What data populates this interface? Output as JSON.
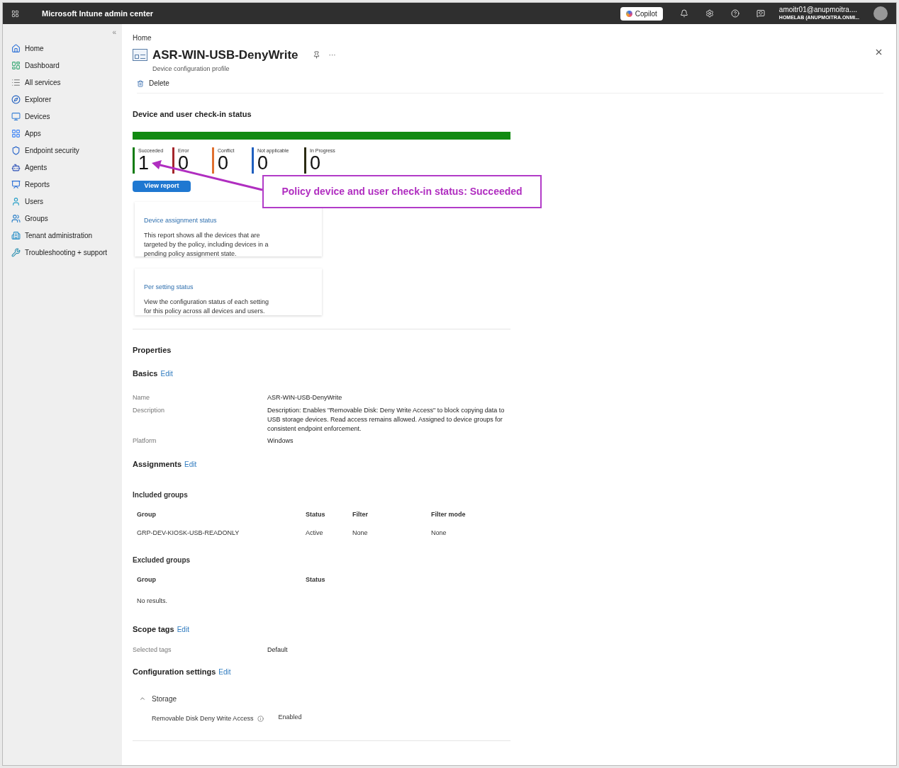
{
  "top_bar": {
    "title": "Microsoft Intune admin center",
    "copilot": "Copilot",
    "account": {
      "user": "amoitr01@anupmoitra....",
      "tenant": "HOMELAB (ANUPMOITRA.ONMI..."
    }
  },
  "sidebar": {
    "collapse": "«",
    "items": [
      {
        "label": "Home",
        "kind": "home"
      },
      {
        "label": "Dashboard",
        "kind": "dashboard"
      },
      {
        "label": "All services",
        "kind": "list"
      },
      {
        "label": "Explorer",
        "kind": "explorer"
      },
      {
        "label": "Devices",
        "kind": "devices"
      },
      {
        "label": "Apps",
        "kind": "apps"
      },
      {
        "label": "Endpoint security",
        "kind": "security"
      },
      {
        "label": "Agents",
        "kind": "agents"
      },
      {
        "label": "Reports",
        "kind": "reports"
      },
      {
        "label": "Users",
        "kind": "users"
      },
      {
        "label": "Groups",
        "kind": "groups"
      },
      {
        "label": "Tenant administration",
        "kind": "tenant"
      },
      {
        "label": "Troubleshooting + support",
        "kind": "tools"
      }
    ]
  },
  "breadcrumb": "Home",
  "header": {
    "title": "ASR-WIN-USB-DenyWrite",
    "subtitle": "Device configuration profile",
    "more": "···"
  },
  "toolbar": {
    "delete": "Delete"
  },
  "checkin": {
    "title": "Device and user check-in status",
    "bar": {
      "level": 1
    },
    "stats": [
      {
        "label": "Succeeded",
        "count": "1",
        "color": "#107c10"
      },
      {
        "label": "Error",
        "count": "0",
        "color": "#a4262c"
      },
      {
        "label": "Conflict",
        "count": "0",
        "color": "#e07030"
      },
      {
        "label": "Not applicable",
        "count": "0",
        "color": "#1f5fbf"
      },
      {
        "label": "In Progress",
        "count": "0",
        "color": "#2b2b12"
      }
    ],
    "view_report": "View report",
    "cards": [
      {
        "title": "Device assignment status",
        "text": "This report shows all the devices that are targeted by the policy, including devices in a pending policy assignment state."
      },
      {
        "title": "Per setting status",
        "text": "View the configuration status of each setting for this policy across all devices and users."
      }
    ]
  },
  "annotation": {
    "text": "Policy device and user check-in status: Succeeded"
  },
  "properties": {
    "title": "Properties",
    "basics": {
      "title": "Basics",
      "edit": "Edit",
      "fields": [
        {
          "label": "Name",
          "value": "ASR-WIN-USB-DenyWrite"
        },
        {
          "label": "Description",
          "value": "Description: Enables \"Removable Disk: Deny Write Access\" to block copying data to USB storage devices. Read access remains allowed. Assigned to device groups for consistent endpoint enforcement."
        },
        {
          "label": "Platform",
          "value": "Windows"
        }
      ]
    },
    "assignments": {
      "title": "Assignments",
      "edit": "Edit",
      "included": {
        "title": "Included groups",
        "columns": [
          "Group",
          "Status",
          "Filter",
          "Filter mode"
        ],
        "rows": [
          [
            "GRP-DEV-KIOSK-USB-READONLY",
            "Active",
            "None",
            "None"
          ]
        ]
      },
      "excluded": {
        "title": "Excluded groups",
        "columns": [
          "Group",
          "Status"
        ],
        "empty": "No results."
      }
    },
    "scope_tags": {
      "title": "Scope tags",
      "edit": "Edit",
      "fields": [
        {
          "label": "Selected tags",
          "value": "Default"
        }
      ]
    },
    "configuration": {
      "title": "Configuration settings",
      "edit": "Edit",
      "group": {
        "title": "Storage",
        "expanded": true,
        "settings": [
          {
            "name": "Removable Disk Deny Write Access",
            "value": "Enabled"
          }
        ]
      }
    }
  }
}
